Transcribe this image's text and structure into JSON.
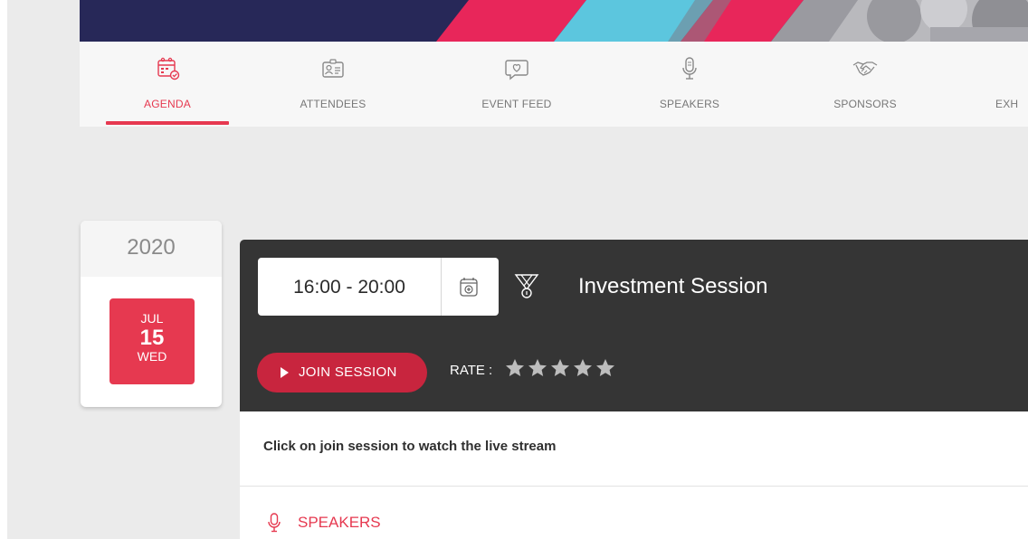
{
  "nav": {
    "items": [
      {
        "label": "AGENDA",
        "icon": "calendar-check-icon"
      },
      {
        "label": "ATTENDEES",
        "icon": "id-card-icon"
      },
      {
        "label": "EVENT FEED",
        "icon": "heart-chat-icon"
      },
      {
        "label": "SPEAKERS",
        "icon": "microphone-icon"
      },
      {
        "label": "SPONSORS",
        "icon": "handshake-icon"
      },
      {
        "label": "EXH",
        "icon": ""
      }
    ],
    "active": "AGENDA"
  },
  "date_card": {
    "year": "2020",
    "month": "JUL",
    "day": "15",
    "weekday": "WED"
  },
  "session": {
    "time": "16:00 - 20:00",
    "title": "Investment Session",
    "join_label": "JOIN SESSION",
    "rate_label": "RATE :",
    "rating_stars": 5,
    "description": "Click on join session to watch the live stream",
    "speakers_heading": "SPEAKERS"
  },
  "colors": {
    "accent": "#e63950",
    "join_button": "#c8253e",
    "session_header_bg": "#353535",
    "banner_navy": "#272858",
    "banner_cyan": "#5cc6de"
  }
}
